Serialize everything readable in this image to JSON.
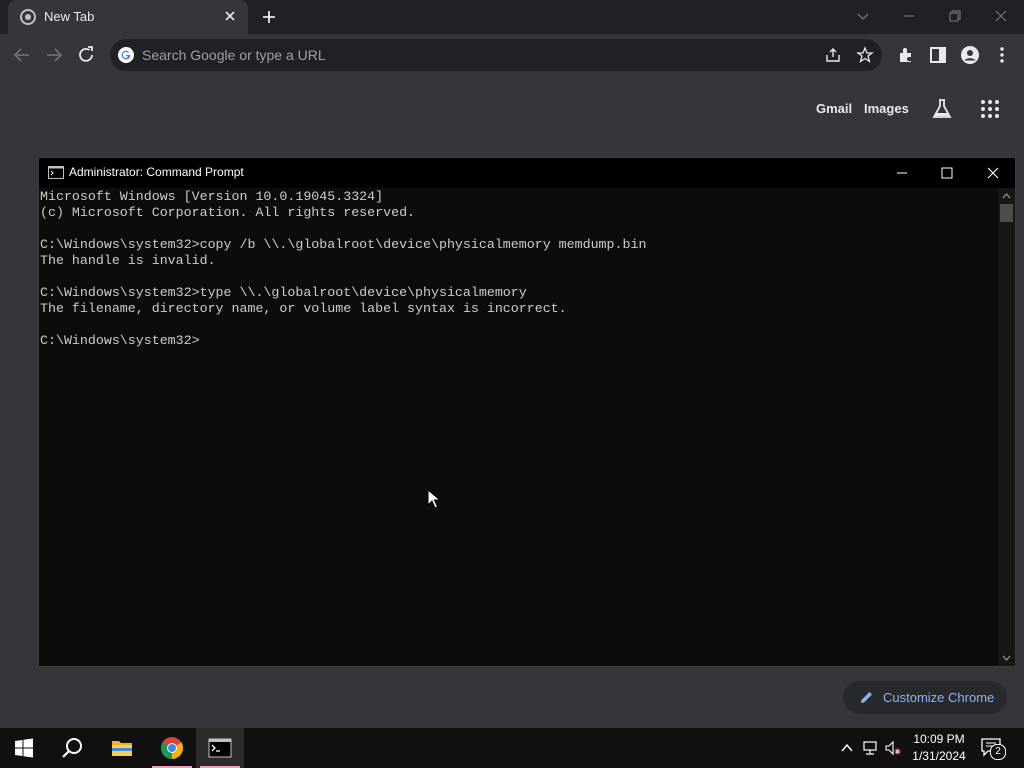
{
  "browser": {
    "tab": {
      "title": "New Tab"
    },
    "omnibox": {
      "placeholder": "Search Google or type a URL"
    },
    "ntp": {
      "gmail": "Gmail",
      "images": "Images",
      "customize": "Customize Chrome"
    }
  },
  "cmd": {
    "title": "Administrator: Command Prompt",
    "lines": [
      "Microsoft Windows [Version 10.0.19045.3324]",
      "(c) Microsoft Corporation. All rights reserved.",
      "",
      "C:\\Windows\\system32>copy /b \\\\.\\globalroot\\device\\physicalmemory memdump.bin",
      "The handle is invalid.",
      "",
      "C:\\Windows\\system32>type \\\\.\\globalroot\\device\\physicalmemory",
      "The filename, directory name, or volume label syntax is incorrect.",
      "",
      "C:\\Windows\\system32>"
    ]
  },
  "taskbar": {
    "time": "10:09 PM",
    "date": "1/31/2024",
    "notifications": "2"
  },
  "colors": {
    "accent": "#8ab4f8",
    "console_bg": "#0c0c0c",
    "console_text": "#cccccc"
  }
}
